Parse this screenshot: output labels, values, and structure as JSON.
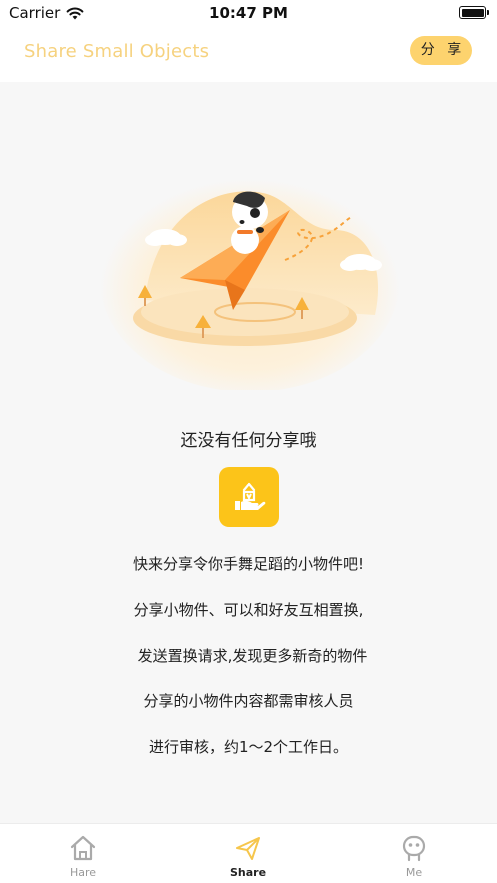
{
  "status_bar": {
    "carrier": "Carrier",
    "time": "10:47 PM"
  },
  "nav": {
    "title": "Share Small Objects",
    "share_button": "分 享"
  },
  "empty_state": {
    "title": "还没有任何分享哦",
    "lines": [
      "快来分享令你手舞足蹈的小物件吧!",
      "分享小物件、可以和好友互相置换,",
      "发送置换请求,发现更多新奇的物件",
      "分享的小物件内容都需审核人员",
      "进行审核，约1～2个工作日。"
    ]
  },
  "tabs": [
    {
      "label": "Hare",
      "icon": "home-icon",
      "active": false
    },
    {
      "label": "Share",
      "icon": "paper-plane-icon",
      "active": true
    },
    {
      "label": "Me",
      "icon": "robot-face-icon",
      "active": false
    }
  ],
  "colors": {
    "accent": "#fcc419",
    "nav_title": "#f6d27f",
    "share_button": "#fdd36e"
  }
}
